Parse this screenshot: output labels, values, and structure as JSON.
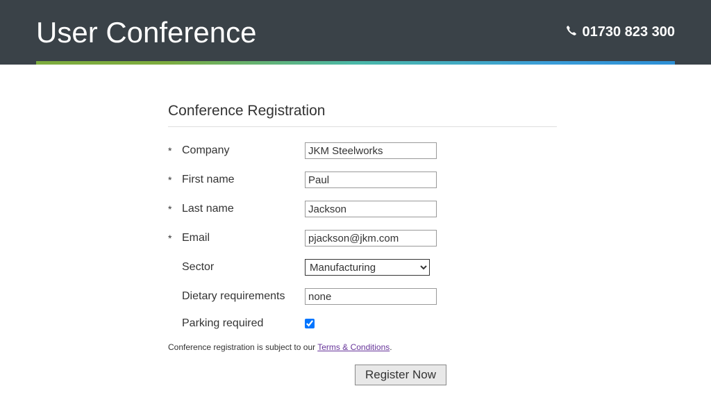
{
  "header": {
    "title": "User Conference",
    "phone": "01730 823 300"
  },
  "form": {
    "title": "Conference Registration",
    "fields": {
      "company": {
        "label": "Company",
        "value": "JKM Steelworks",
        "required": "*"
      },
      "first_name": {
        "label": "First name",
        "value": "Paul",
        "required": "*"
      },
      "last_name": {
        "label": "Last name",
        "value": "Jackson",
        "required": "*"
      },
      "email": {
        "label": "Email",
        "value": "pjackson@jkm.com",
        "required": "*"
      },
      "sector": {
        "label": "Sector",
        "value": "Manufacturing"
      },
      "dietary": {
        "label": "Dietary requirements",
        "value": "none"
      },
      "parking": {
        "label": "Parking required",
        "checked": true
      }
    },
    "terms_prefix": "Conference registration is subject to our ",
    "terms_link": "Terms & Conditions",
    "terms_suffix": ".",
    "submit_label": "Register Now"
  }
}
